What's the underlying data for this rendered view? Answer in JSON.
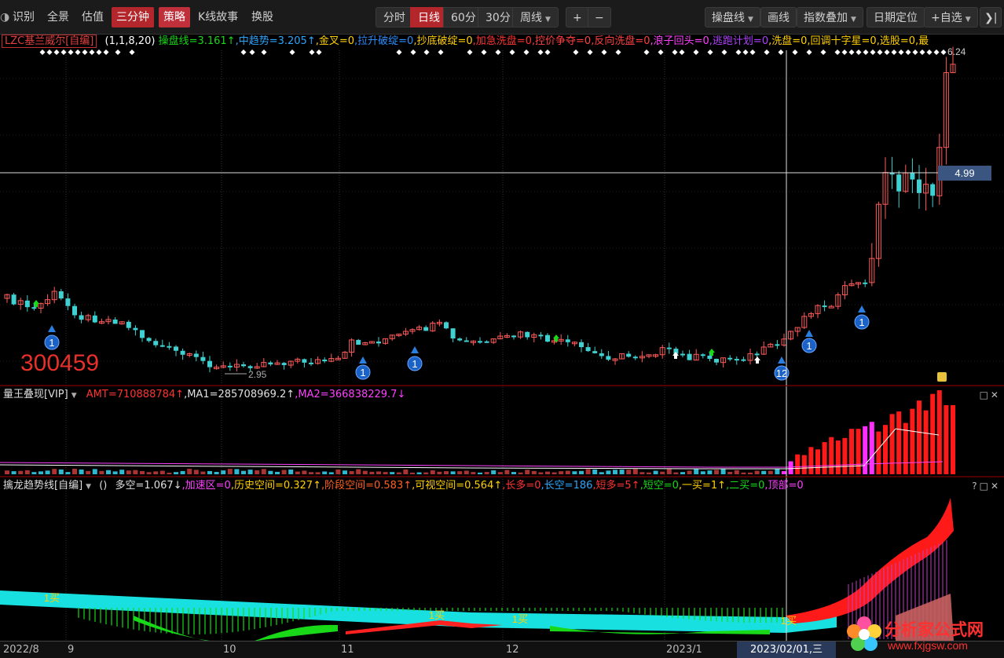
{
  "toolbar": {
    "left_icon": "◑",
    "items": [
      "识别",
      "全景",
      "估值"
    ],
    "active_mode": "三分钟",
    "strategy": "策略",
    "kline_story": "K线故事",
    "switch_stock": "换股",
    "periods": [
      "分时",
      "日线",
      "60分",
      "30分"
    ],
    "active_period": "日线",
    "weekly": "周线",
    "plus": "+",
    "minus": "−",
    "trade_line": "操盘线",
    "draw_line": "画线",
    "index_overlay": "指数叠加",
    "date_locate": "日期定位",
    "add_watch": "+自选",
    "expand_icon": "❯|"
  },
  "main_header": {
    "name": "LZC基兰威尔[自编]",
    "params": "(1,1,8,20)",
    "items": [
      {
        "text": "操盘线=3.161↑",
        "color": "#18d818"
      },
      {
        "text": ",中趋势=3.205↑",
        "color": "#2aa6ff"
      },
      {
        "text": ",金叉=0",
        "color": "#ffd000"
      },
      {
        "text": ",拉升破绽=0",
        "color": "#2a8fff"
      },
      {
        "text": ",抄底破绽=0",
        "color": "#ffd000"
      },
      {
        "text": ",加急洗盘=0",
        "color": "#ff3333"
      },
      {
        "text": ",控价争夺=0",
        "color": "#ff4040"
      },
      {
        "text": ",反向洗盘=0",
        "color": "#ff4040"
      },
      {
        "text": ",浪子回头=0",
        "color": "#ff40ff"
      },
      {
        "text": ",逃跑计划=0",
        "color": "#b040ff"
      },
      {
        "text": ",洗盘=0",
        "color": "#ffd000"
      },
      {
        "text": ",回调十字星=0",
        "color": "#ffd000"
      },
      {
        "text": ",选股=0",
        "color": "#ffd000"
      },
      {
        "text": ",最",
        "color": "#ffd000"
      }
    ]
  },
  "main_chart": {
    "stock_code": "300459",
    "price_high": "6.24",
    "price_cross": "4.99",
    "price_low": "2.95",
    "signal_label": "1",
    "signal_label_2": "12"
  },
  "volume_header": {
    "name": "量王叠现[VIP]",
    "items": [
      {
        "text": "AMT=710888784↑",
        "color": "#ff3333"
      },
      {
        "text": ",MA1=285708969.2↑",
        "color": "#e0e0e0"
      },
      {
        "text": ",MA2=366838229.7↓",
        "color": "#ff40ff"
      }
    ]
  },
  "trend_header": {
    "name": "擒龙趋势线[自编]",
    "params": "()",
    "items": [
      {
        "text": "多空=1.067↓",
        "color": "#e0e0e0"
      },
      {
        "text": ",加速区=0",
        "color": "#ff40ff"
      },
      {
        "text": ",历史空间=0.327↑",
        "color": "#ffd000"
      },
      {
        "text": ",阶段空间=0.583↑",
        "color": "#ff6020"
      },
      {
        "text": ",可视空间=0.564↑",
        "color": "#ffd000"
      },
      {
        "text": ",长多=0",
        "color": "#ff3333"
      },
      {
        "text": ",长空=186",
        "color": "#2aa6ff"
      },
      {
        "text": ",短多=5↑",
        "color": "#ff3333"
      },
      {
        "text": ",短空=0",
        "color": "#18d818"
      },
      {
        "text": ",一买=1↑",
        "color": "#ffd000"
      },
      {
        "text": ",二买=0",
        "color": "#18d818"
      },
      {
        "text": ",顶部=0",
        "color": "#ff40ff"
      }
    ],
    "buy_label": "1买"
  },
  "xaxis": {
    "labels": [
      "2022/8",
      "9",
      "10",
      "11",
      "12",
      "2023/1"
    ],
    "cursor_date": "2023/02/01,三"
  },
  "watermark": {
    "title": "分析家公式网",
    "url": "www.fxjgsw.com"
  },
  "colors": {
    "up": "#ff5a5a",
    "down": "#3fd1d1",
    "volume_up": "#ff1a1a",
    "accent": "#b3262b"
  }
}
